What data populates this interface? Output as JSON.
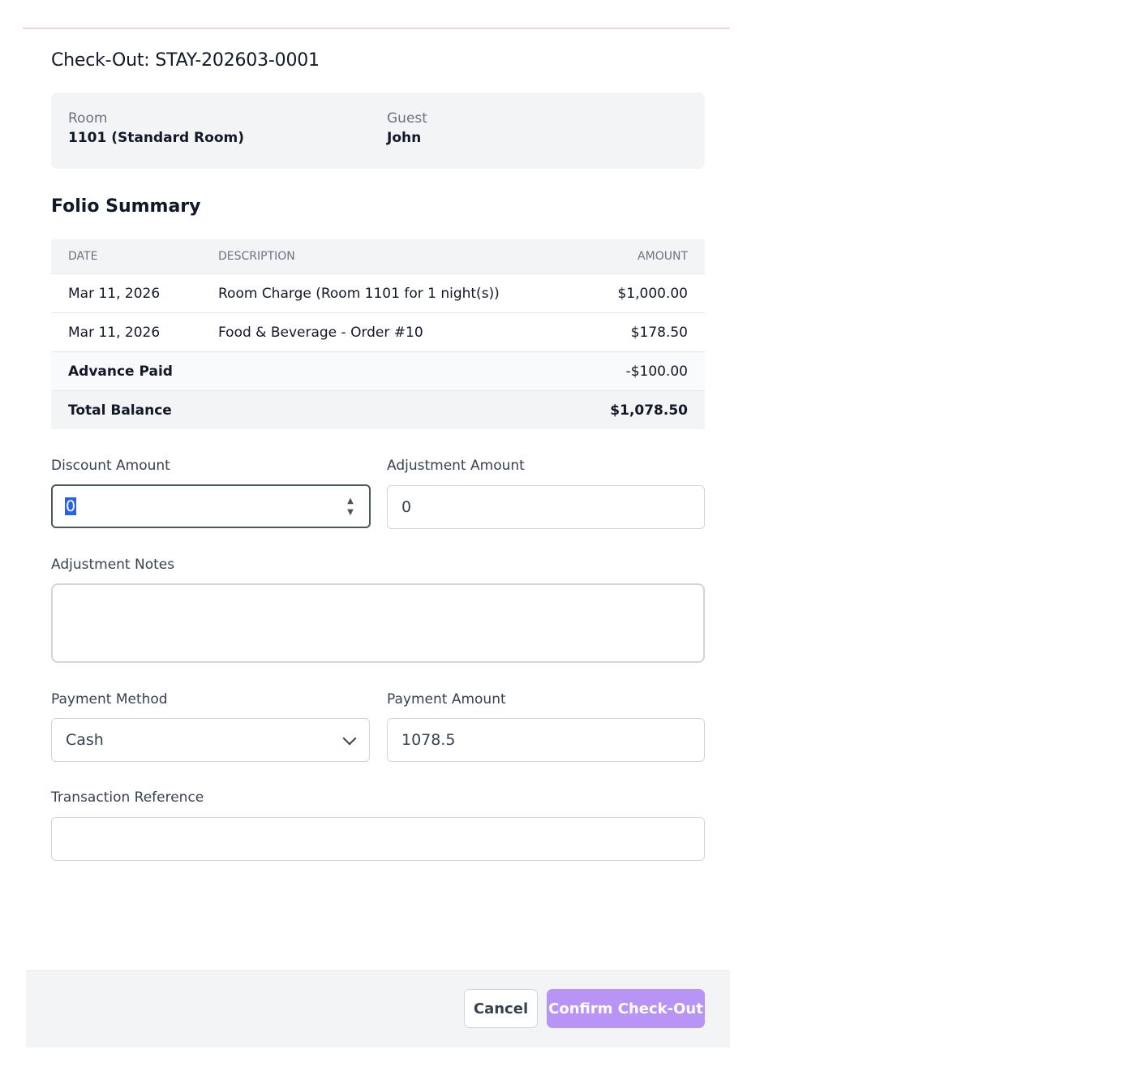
{
  "dialog": {
    "title": "Check-Out: STAY-202603-0001"
  },
  "info": {
    "room_label": "Room",
    "room_value": "1101 (Standard Room)",
    "guest_label": "Guest",
    "guest_value": "John"
  },
  "folio": {
    "title": "Folio Summary",
    "columns": [
      "DATE",
      "DESCRIPTION",
      "AMOUNT"
    ],
    "rows": [
      {
        "date": "Mar 11, 2026",
        "description": "Room Charge (Room 1101 for 1 night(s))",
        "amount": "$1,000.00"
      },
      {
        "date": "Mar 11, 2026",
        "description": "Food & Beverage - Order #10",
        "amount": "$178.50"
      }
    ],
    "advance_label": "Advance Paid",
    "advance_amount": "-$100.00",
    "total_label": "Total Balance",
    "total_amount": "$1,078.50"
  },
  "form": {
    "discount_label": "Discount Amount",
    "discount_value": "0",
    "adjustment_label": "Adjustment Amount",
    "adjustment_value": "0",
    "notes_label": "Adjustment Notes",
    "notes_value": "",
    "payment_method_label": "Payment Method",
    "payment_method_value": "Cash",
    "payment_amount_label": "Payment Amount",
    "payment_amount_value": "1078.5",
    "transaction_ref_label": "Transaction Reference",
    "transaction_ref_value": ""
  },
  "footer": {
    "cancel_label": "Cancel",
    "confirm_label": "Confirm Check-Out"
  },
  "colors": {
    "confirm_button": "#b794f6",
    "selection": "#2563eb"
  }
}
